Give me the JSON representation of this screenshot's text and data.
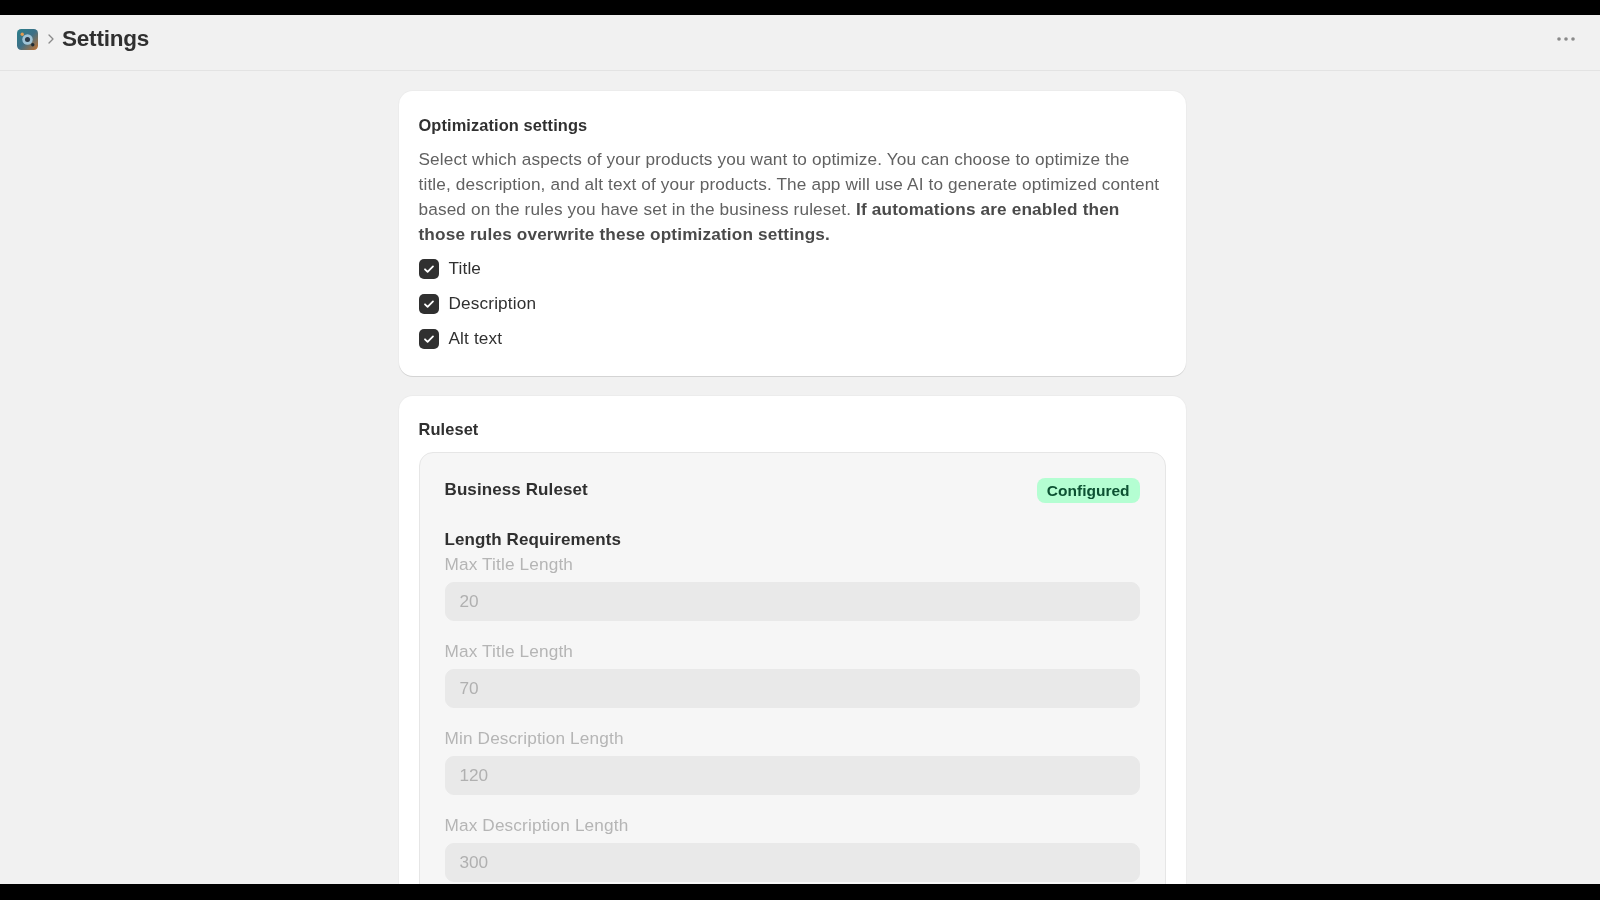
{
  "header": {
    "title": "Settings"
  },
  "optimization_card": {
    "title": "Optimization settings",
    "description": "Select which aspects of your products you want to optimize. You can choose to optimize the title, description, and alt text of your products. The app will use AI to generate optimized content based on the rules you have set in the business ruleset. **If automations are enabled then those rules overwrite these optimization settings.**",
    "options": [
      {
        "label": "Title",
        "checked": true
      },
      {
        "label": "Description",
        "checked": true
      },
      {
        "label": "Alt text",
        "checked": true
      }
    ]
  },
  "ruleset_card": {
    "title": "Ruleset",
    "ruleset": {
      "name": "Business Ruleset",
      "badge": "Configured",
      "section_title": "Length Requirements",
      "fields": [
        {
          "label": "Max Title Length",
          "value": "20",
          "disabled": true
        },
        {
          "label": "Max Title Length",
          "value": "70",
          "disabled": true
        },
        {
          "label": "Min Description Length",
          "value": "120",
          "disabled": true
        },
        {
          "label": "Max Description Length",
          "value": "300",
          "disabled": true
        }
      ]
    }
  }
}
